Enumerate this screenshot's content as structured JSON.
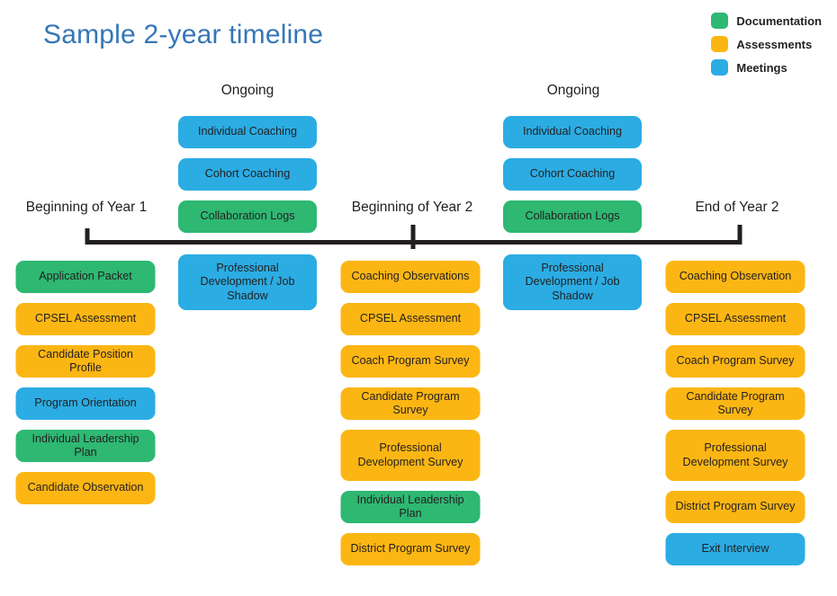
{
  "title": "Sample 2-year timeline",
  "colors": {
    "documentation": "#2eb872",
    "assessments": "#fcb614",
    "meetings": "#2bace3",
    "title": "#3576b8",
    "axis": "#231f20"
  },
  "legend": {
    "items": [
      {
        "label": "Documentation",
        "color_key": "documentation"
      },
      {
        "label": "Assessments",
        "color_key": "assessments"
      },
      {
        "label": "Meetings",
        "color_key": "meetings"
      }
    ]
  },
  "headers": {
    "ongoing_year1": "Ongoing",
    "ongoing_year2": "Ongoing",
    "beginning_year1": "Beginning of Year 1",
    "beginning_year2": "Beginning of Year 2",
    "end_year2": "End of Year 2"
  },
  "columns": {
    "year1_start": {
      "items": [
        {
          "label": "Application Packet",
          "category": "Documentation"
        },
        {
          "label": "CPSEL Assessment",
          "category": "Assessments"
        },
        {
          "label": "Candidate Position Profile",
          "category": "Assessments"
        },
        {
          "label": "Program Orientation",
          "category": "Meetings"
        },
        {
          "label": "Individual Leadership Plan",
          "category": "Documentation"
        },
        {
          "label": "Candidate Observation",
          "category": "Assessments"
        }
      ]
    },
    "year1_ongoing_top": {
      "items": [
        {
          "label": "Individual Coaching",
          "category": "Meetings"
        },
        {
          "label": "Cohort Coaching",
          "category": "Meetings"
        },
        {
          "label": "Collaboration Logs",
          "category": "Documentation"
        }
      ]
    },
    "year1_ongoing_bottom": {
      "items": [
        {
          "label": "Professional Development / Job Shadow",
          "category": "Meetings"
        }
      ]
    },
    "year2_start": {
      "items": [
        {
          "label": "Coaching Observations",
          "category": "Assessments"
        },
        {
          "label": "CPSEL Assessment",
          "category": "Assessments"
        },
        {
          "label": "Coach Program Survey",
          "category": "Assessments"
        },
        {
          "label": "Candidate Program Survey",
          "category": "Assessments"
        },
        {
          "label": "Professional Development Survey",
          "category": "Assessments"
        },
        {
          "label": "Individual Leadership Plan",
          "category": "Documentation"
        },
        {
          "label": "District Program Survey",
          "category": "Assessments"
        }
      ]
    },
    "year2_ongoing_top": {
      "items": [
        {
          "label": "Individual Coaching",
          "category": "Meetings"
        },
        {
          "label": "Cohort Coaching",
          "category": "Meetings"
        },
        {
          "label": "Collaboration Logs",
          "category": "Documentation"
        }
      ]
    },
    "year2_ongoing_bottom": {
      "items": [
        {
          "label": "Professional Development / Job Shadow",
          "category": "Meetings"
        }
      ]
    },
    "year2_end": {
      "items": [
        {
          "label": "Coaching Observation",
          "category": "Assessments"
        },
        {
          "label": "CPSEL Assessment",
          "category": "Assessments"
        },
        {
          "label": "Coach Program Survey",
          "category": "Assessments"
        },
        {
          "label": "Candidate Program Survey",
          "category": "Assessments"
        },
        {
          "label": "Professional Development Survey",
          "category": "Assessments"
        },
        {
          "label": "District Program Survey",
          "category": "Assessments"
        },
        {
          "label": "Exit Interview",
          "category": "Meetings"
        }
      ]
    }
  }
}
